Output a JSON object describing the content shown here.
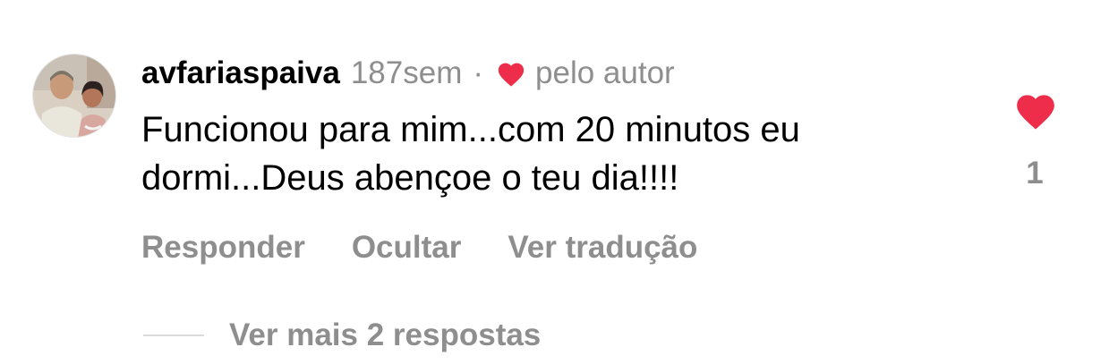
{
  "comment": {
    "username": "avfariaspaiva",
    "time_ago": "187sem",
    "separator": "·",
    "author_liked_label": "pelo autor",
    "text": "Funcionou para mim...com 20 minutos eu dormi...Deus abençoe o teu dia!!!!",
    "like_count": "1",
    "actions": {
      "reply": "Responder",
      "hide": "Ocultar",
      "translate": "Ver tradução"
    },
    "more_replies_label": "Ver mais 2 respostas"
  },
  "icons": {
    "author_heart": "heart-icon",
    "like": "heart-icon"
  },
  "colors": {
    "heart": "#ed2d4a",
    "secondary_text": "#8e8e8e",
    "primary_text": "#000000",
    "divider": "#dbdbdb"
  }
}
